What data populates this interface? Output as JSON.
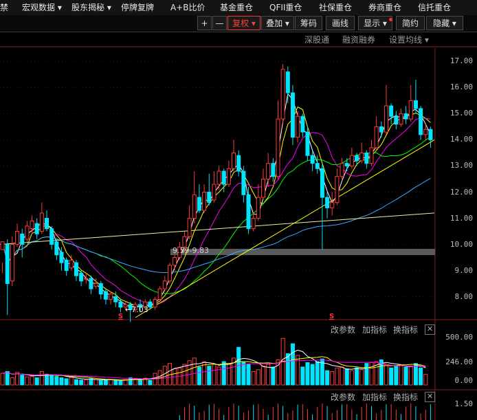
{
  "menu": {
    "items": [
      {
        "label": "禁"
      },
      {
        "label": "宏观数据 ▾"
      },
      {
        "label": "股东揭秘 ▾"
      },
      {
        "label": "停牌复牌"
      },
      {
        "label": "A+B比价"
      },
      {
        "label": "基金重仓"
      },
      {
        "label": "QFII重仓"
      },
      {
        "label": "社保重仓"
      },
      {
        "label": "券商重仓"
      },
      {
        "label": "信托重仓"
      }
    ]
  },
  "toolbar": {
    "plus": "+",
    "minus": "—",
    "fuquan": "复权 ▾",
    "diejia": "叠加 ▾",
    "chouma": "筹码",
    "huaxian": "画线",
    "xianshi": "显示 ▾",
    "jianyue": "简约",
    "yincang": "隐藏 ▾"
  },
  "subbar": {
    "shengutong": "深股通",
    "rongzi": "融资融券",
    "junxian": "设置均线 ▾"
  },
  "colors": {
    "up": "#ff3b3b",
    "down": "#00e5ff",
    "ma1": "#ffffff",
    "ma2": "#ffff00",
    "ma3": "#ff00ff",
    "ma4": "#00ff00",
    "ma5": "#3fa9ff",
    "ma6": "#f0f0a0"
  },
  "price_axis": {
    "ticks": [
      "17.00",
      "16.00",
      "15.00",
      "14.00",
      "13.00",
      "12.00",
      "11.00",
      "10.00",
      "9.00",
      "8.00"
    ]
  },
  "annotations": {
    "low": "←7.03",
    "zone": "9.59-9.83",
    "marker1": "S",
    "marker2": "S"
  },
  "panel2": {
    "gaicanshu": "改参数",
    "jiazhibiao": "加指标",
    "huanzhibiao": "换指标",
    "close": "✕",
    "ticks": [
      "500.00",
      "246.00",
      "0.00"
    ]
  },
  "panel3": {
    "gaicanshu": "改参数",
    "jiazhibiao": "加指标",
    "huanzhibiao": "换指标",
    "close": "✕",
    "ticks": [
      "1.50"
    ]
  },
  "chart_data": {
    "type": "candlestick",
    "ylim": [
      7.2,
      17.3
    ],
    "candles": [
      [
        9.8,
        10.1,
        9.3,
        8.9
      ],
      [
        10.0,
        8.5,
        10.2,
        7.3
      ],
      [
        8.6,
        10.0,
        10.3,
        8.4
      ],
      [
        10.0,
        10.5,
        10.8,
        9.9
      ],
      [
        10.4,
        10.0,
        10.6,
        9.5
      ],
      [
        10.2,
        10.7,
        10.9,
        10.1
      ],
      [
        10.6,
        10.9,
        11.1,
        10.4
      ],
      [
        10.8,
        10.4,
        11.0,
        10.2
      ],
      [
        10.5,
        11.2,
        11.6,
        10.4
      ],
      [
        11.0,
        10.6,
        11.3,
        10.5
      ],
      [
        10.6,
        10.0,
        10.7,
        9.8
      ],
      [
        10.1,
        9.6,
        10.2,
        9.4
      ],
      [
        9.7,
        9.3,
        9.9,
        9.0
      ],
      [
        9.4,
        9.0,
        9.5,
        8.8
      ],
      [
        9.1,
        9.4,
        9.6,
        9.0
      ],
      [
        9.3,
        8.8,
        9.4,
        8.6
      ],
      [
        8.9,
        8.6,
        9.0,
        8.4
      ],
      [
        8.7,
        8.7,
        8.9,
        8.5
      ],
      [
        8.7,
        8.3,
        8.8,
        8.1
      ],
      [
        8.4,
        8.5,
        8.7,
        8.3
      ],
      [
        8.5,
        8.1,
        8.6,
        7.9
      ],
      [
        8.2,
        7.9,
        8.3,
        7.7
      ],
      [
        7.9,
        8.1,
        8.2,
        7.7
      ],
      [
        8.0,
        7.8,
        8.2,
        7.6
      ],
      [
        7.8,
        7.6,
        7.9,
        7.4
      ],
      [
        7.6,
        7.7,
        7.8,
        7.5
      ],
      [
        7.7,
        7.5,
        7.8,
        7.03
      ],
      [
        7.5,
        7.7,
        7.8,
        7.4
      ],
      [
        7.7,
        7.6,
        7.9,
        7.4
      ],
      [
        7.6,
        7.8,
        7.9,
        7.5
      ],
      [
        7.8,
        7.6,
        7.9,
        7.5
      ],
      [
        7.6,
        7.9,
        8.0,
        7.5
      ],
      [
        7.9,
        8.3,
        8.4,
        7.8
      ],
      [
        8.3,
        8.6,
        8.8,
        8.2
      ],
      [
        8.6,
        9.2,
        9.3,
        8.5
      ],
      [
        9.2,
        9.5,
        9.6,
        9.0
      ],
      [
        9.5,
        9.9,
        10.1,
        9.4
      ],
      [
        9.9,
        10.3,
        10.5,
        9.7
      ],
      [
        10.3,
        11.0,
        11.5,
        10.2
      ],
      [
        11.0,
        11.9,
        12.8,
        10.8
      ],
      [
        11.8,
        11.3,
        12.3,
        11.2
      ],
      [
        11.3,
        12.0,
        12.3,
        11.2
      ],
      [
        12.0,
        11.6,
        12.7,
        11.5
      ],
      [
        11.7,
        12.3,
        12.8,
        11.6
      ],
      [
        12.3,
        12.8,
        13.0,
        12.1
      ],
      [
        12.8,
        12.3,
        12.9,
        12.0
      ],
      [
        12.3,
        12.9,
        13.2,
        12.2
      ],
      [
        12.9,
        13.5,
        14.0,
        12.8
      ],
      [
        13.4,
        12.8,
        13.6,
        12.6
      ],
      [
        12.8,
        11.9,
        13.0,
        11.6
      ],
      [
        11.9,
        10.6,
        12.2,
        10.4
      ],
      [
        10.6,
        11.0,
        11.2,
        10.5
      ],
      [
        11.0,
        11.8,
        12.3,
        10.9
      ],
      [
        11.8,
        12.5,
        12.9,
        11.7
      ],
      [
        12.5,
        13.1,
        13.5,
        12.2
      ],
      [
        13.1,
        12.6,
        13.3,
        12.4
      ],
      [
        12.6,
        14.8,
        15.5,
        12.5
      ],
      [
        14.8,
        16.7,
        16.9,
        14.6
      ],
      [
        16.6,
        15.8,
        16.8,
        15.4
      ],
      [
        15.8,
        14.1,
        16.1,
        13.8
      ],
      [
        14.1,
        14.9,
        15.1,
        13.9
      ],
      [
        14.9,
        14.3,
        15.0,
        14.1
      ],
      [
        14.3,
        13.4,
        14.5,
        13.2
      ],
      [
        13.4,
        13.1,
        13.6,
        12.8
      ],
      [
        13.1,
        12.9,
        13.4,
        12.7
      ],
      [
        12.9,
        11.8,
        13.1,
        9.8
      ],
      [
        11.8,
        11.4,
        12.0,
        11.0
      ],
      [
        11.4,
        11.6,
        12.0,
        11.1
      ],
      [
        11.6,
        12.6,
        12.9,
        11.5
      ],
      [
        12.6,
        13.1,
        13.3,
        12.5
      ],
      [
        13.1,
        13.0,
        13.3,
        12.8
      ],
      [
        13.0,
        13.4,
        13.7,
        12.9
      ],
      [
        13.4,
        13.2,
        13.5,
        13.0
      ],
      [
        13.2,
        13.5,
        13.9,
        13.1
      ],
      [
        13.5,
        13.1,
        13.6,
        12.9
      ],
      [
        13.1,
        13.7,
        14.0,
        13.0
      ],
      [
        13.7,
        14.5,
        14.9,
        13.6
      ],
      [
        14.5,
        14.3,
        14.7,
        14.1
      ],
      [
        14.3,
        15.3,
        16.1,
        14.2
      ],
      [
        15.3,
        14.9,
        15.4,
        14.6
      ],
      [
        14.9,
        14.6,
        15.1,
        14.4
      ],
      [
        14.6,
        15.0,
        15.2,
        14.5
      ],
      [
        15.0,
        14.8,
        15.3,
        14.6
      ],
      [
        14.8,
        15.5,
        16.1,
        14.7
      ],
      [
        15.5,
        15.2,
        16.3,
        15.0
      ],
      [
        15.2,
        14.2,
        15.3,
        14.0
      ],
      [
        14.2,
        14.4,
        14.6,
        14.0
      ],
      [
        14.4,
        14.0,
        14.5,
        13.7
      ]
    ],
    "volume": {
      "ylim": [
        0,
        560
      ],
      "values": [
        130,
        150,
        80,
        140,
        110,
        90,
        95,
        80,
        150,
        120,
        110,
        95,
        80,
        70,
        85,
        60,
        55,
        55,
        70,
        60,
        50,
        50,
        60,
        55,
        45,
        60,
        80,
        70,
        65,
        75,
        50,
        130,
        160,
        210,
        240,
        180,
        190,
        230,
        270,
        300,
        200,
        260,
        210,
        230,
        200,
        260,
        240,
        300,
        420,
        260,
        230,
        150,
        170,
        210,
        230,
        200,
        280,
        520,
        350,
        460,
        330,
        200,
        250,
        230,
        260,
        290,
        160,
        150,
        190,
        200,
        180,
        160,
        190,
        170,
        240,
        250,
        260,
        280,
        230,
        190,
        210,
        220,
        200,
        210,
        240,
        190,
        120
      ],
      "ticks": [
        500,
        246,
        0
      ]
    }
  }
}
